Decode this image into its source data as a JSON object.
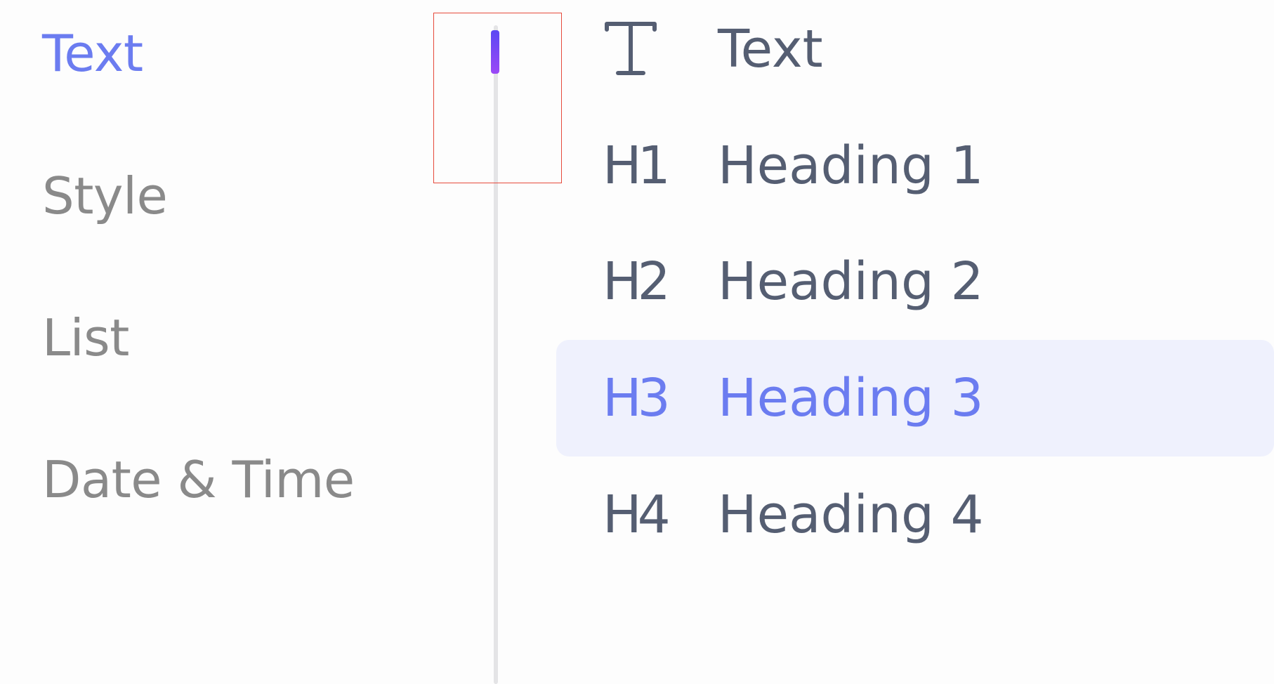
{
  "categories": [
    {
      "label": "Text",
      "active": true
    },
    {
      "label": "Style",
      "active": false
    },
    {
      "label": "List",
      "active": false
    },
    {
      "label": "Date & Time",
      "active": false
    }
  ],
  "options": [
    {
      "icon": "text-icon",
      "icon_text": "",
      "label": "Text",
      "selected": false
    },
    {
      "icon": "h1-icon",
      "icon_text": "H1",
      "label": "Heading 1",
      "selected": false
    },
    {
      "icon": "h2-icon",
      "icon_text": "H2",
      "label": "Heading 2",
      "selected": false
    },
    {
      "icon": "h3-icon",
      "icon_text": "H3",
      "label": "Heading 3",
      "selected": true
    },
    {
      "icon": "h4-icon",
      "icon_text": "H4",
      "label": "Heading 4",
      "selected": false
    }
  ],
  "colors": {
    "accent": "#6b7cf0",
    "text": "#555e72",
    "muted": "#8a8a8a",
    "selected_bg": "#eff1fd",
    "scroll_thumb_top": "#5b48f3",
    "scroll_thumb_bottom": "#9b49f6",
    "focus_outline": "#e64a3c"
  }
}
